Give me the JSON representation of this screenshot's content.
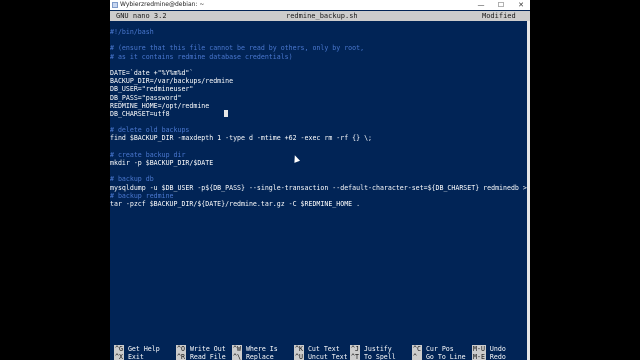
{
  "window": {
    "title": "Wybierzredmine@debian: ~",
    "controls": [
      "—",
      "☐",
      "✕"
    ]
  },
  "nano": {
    "version": "GNU nano 3.2",
    "filename": "redmine_backup.sh",
    "status": "Modified"
  },
  "script": {
    "shebang": "#!/bin/bash",
    "comment1": "# (ensure that this file cannot be read by others, only by root,",
    "comment2": "# as it contains redmine database credentials)",
    "date_line": "DATE=`date +\"%Y%m%d\"`",
    "backup_dir": "BACKUP_DIR=/var/backups/redmine",
    "db_user": "DB_USER=\"redmineuser\"",
    "db_pass": "DB_PASS=\"password\"",
    "redmine_home": "REDMINE_HOME=/opt/redmine",
    "db_charset": "DB_CHARSET=utf8",
    "comment_delete": "# delete old backups",
    "find_line": "find $BACKUP_DIR -maxdepth 1 -type d -mtime +62 -exec rm -rf {} \\;",
    "comment_create": "# create backup dir",
    "mkdir_line": "mkdir -p $BACKUP_DIR/$DATE",
    "comment_backupdb": "# backup db",
    "mysqldump_line": "mysqldump -u $DB_USER -p${DB_PASS} --single-transaction --default-character-set=${DB_CHARSET} redminedb > $",
    "comment_backupredmine": "# backup redmine",
    "tar_line": "tar -pzcf $BACKUP_DIR/${DATE}/redmine.tar.gz -C $REDMINE_HOME ."
  },
  "help": {
    "row1": [
      {
        "key": "^G",
        "label": "Get Help"
      },
      {
        "key": "^O",
        "label": "Write Out"
      },
      {
        "key": "^W",
        "label": "Where Is"
      },
      {
        "key": "^K",
        "label": "Cut Text"
      },
      {
        "key": "^J",
        "label": "Justify"
      },
      {
        "key": "^C",
        "label": "Cur Pos"
      },
      {
        "key": "M-U",
        "label": "Undo"
      }
    ],
    "row2": [
      {
        "key": "^X",
        "label": "Exit"
      },
      {
        "key": "^R",
        "label": "Read File"
      },
      {
        "key": "^\\",
        "label": "Replace"
      },
      {
        "key": "^U",
        "label": "Uncut Text"
      },
      {
        "key": "^T",
        "label": "To Spell"
      },
      {
        "key": "^_",
        "label": "Go To Line"
      },
      {
        "key": "M-E",
        "label": "Redo"
      }
    ]
  },
  "colors": {
    "terminal_bg": "#012456",
    "comment": "#4a78d0",
    "string": "#e8d44d",
    "variable": "#d060d0"
  }
}
